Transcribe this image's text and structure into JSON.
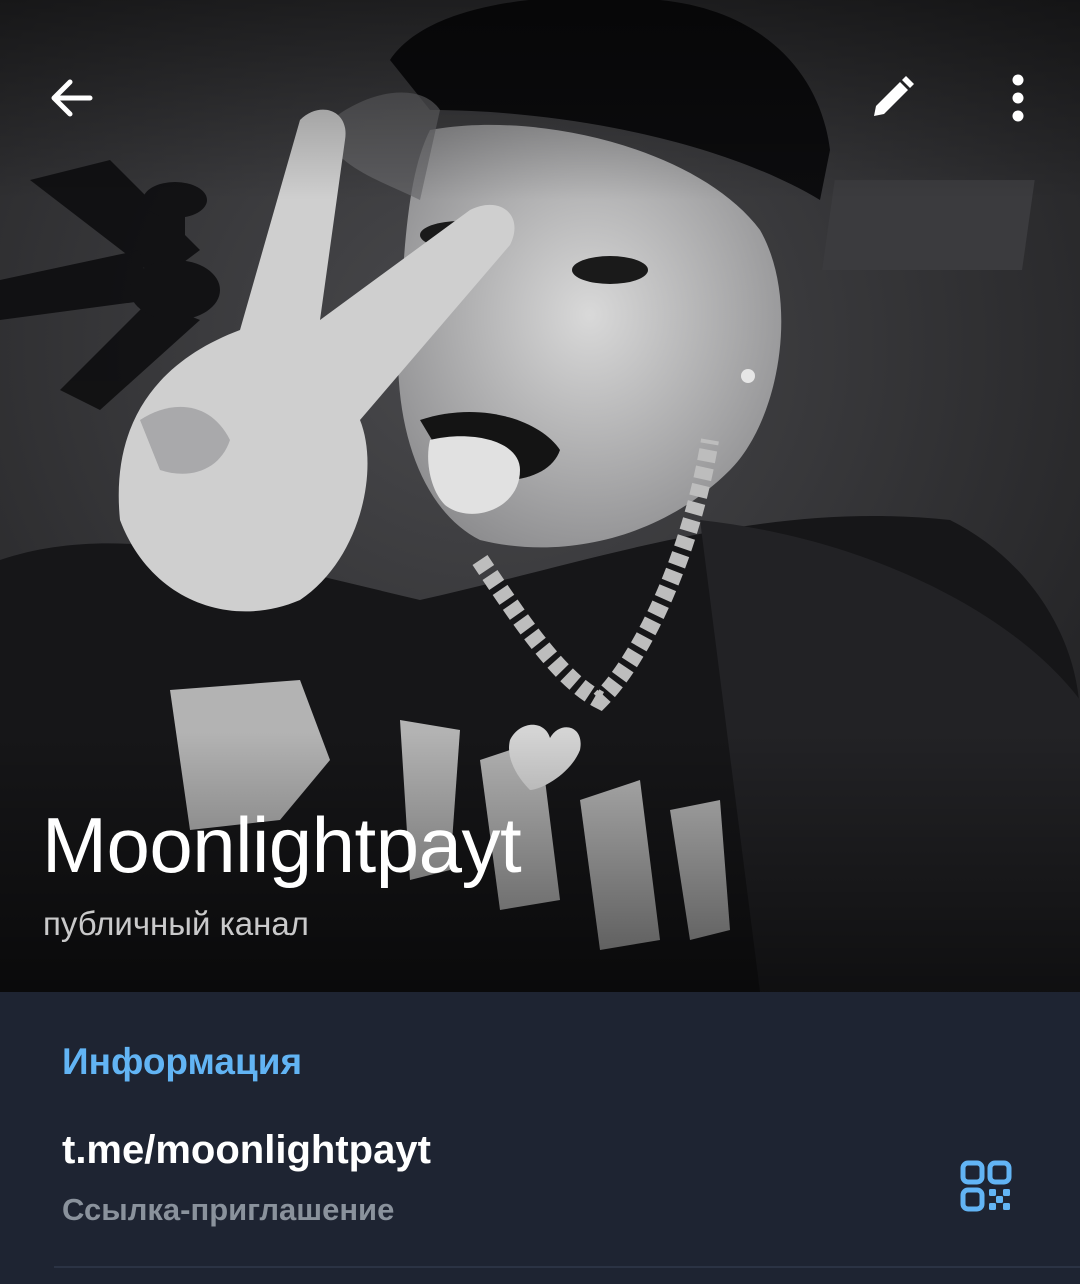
{
  "header": {
    "channel_name": "Moonlightpayt",
    "channel_status": "публичный канал",
    "icons": {
      "back": "arrow-left-icon",
      "edit": "pencil-icon",
      "more": "more-vertical-icon"
    }
  },
  "info": {
    "section_title": "Информация",
    "link_value": "t.me/moonlightpayt",
    "link_caption": "Ссылка-приглашение",
    "qr_icon": "qr-code-icon"
  },
  "colors": {
    "accent": "#62b4f4",
    "panel_background": "#1e2432",
    "caption_gray": "#8a929c"
  }
}
